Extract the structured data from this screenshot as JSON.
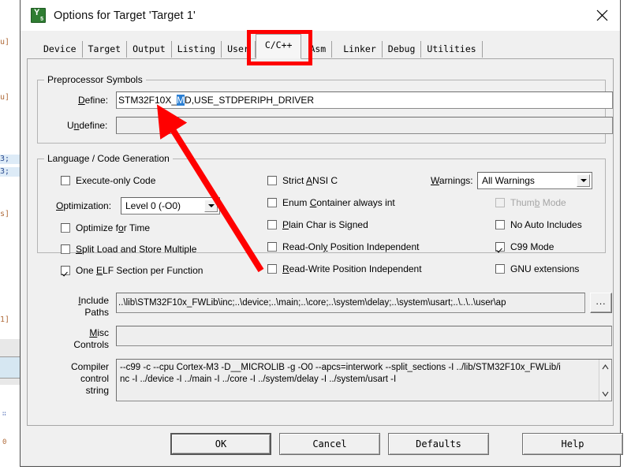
{
  "window": {
    "title": "Options for Target 'Target 1'",
    "icon": "keil-uvision-icon",
    "close_label": "×"
  },
  "tabs": [
    {
      "label": "Device",
      "selected": false
    },
    {
      "label": "Target",
      "selected": false
    },
    {
      "label": "Output",
      "selected": false
    },
    {
      "label": "Listing",
      "selected": false
    },
    {
      "label": "User",
      "selected": false
    },
    {
      "label": "C/C++",
      "selected": true
    },
    {
      "label": "Asm",
      "selected": false
    },
    {
      "label": "Linker",
      "selected": false
    },
    {
      "label": "Debug",
      "selected": false
    },
    {
      "label": "Utilities",
      "selected": false
    }
  ],
  "preprocessor": {
    "legend": "Preprocessor Symbols",
    "define_label": "Define:",
    "define_value_before": "STM32F10X_",
    "define_value_selected": "M",
    "define_value_after": "D,USE_STDPERIPH_DRIVER",
    "define_full_value": "STM32F10X_MD,USE_STDPERIPH_DRIVER",
    "undefine_label": "Undefine:",
    "undefine_value": ""
  },
  "language": {
    "legend": "Language / Code Generation",
    "left_column": [
      {
        "label": "Execute-only Code",
        "checked": false,
        "disabled": false
      },
      {
        "label": "Optimize for Time",
        "checked": false,
        "disabled": false
      },
      {
        "label": "Split Load and Store Multiple",
        "checked": false,
        "disabled": false
      },
      {
        "label": "One ELF Section per Function",
        "checked": true,
        "disabled": false
      }
    ],
    "optimization_label": "Optimization:",
    "optimization_value": "Level 0 (-O0)",
    "middle_column": [
      {
        "label": "Strict ANSI C",
        "checked": false,
        "disabled": false
      },
      {
        "label": "Enum Container always int",
        "checked": false,
        "disabled": false
      },
      {
        "label": "Plain Char is Signed",
        "checked": false,
        "disabled": false
      },
      {
        "label": "Read-Only Position Independent",
        "checked": false,
        "disabled": false
      },
      {
        "label": "Read-Write Position Independent",
        "checked": false,
        "disabled": false
      }
    ],
    "warnings_label": "Warnings:",
    "warnings_value": "All Warnings",
    "right_column": [
      {
        "label": "Thumb Mode",
        "checked": false,
        "disabled": true
      },
      {
        "label": "No Auto Includes",
        "checked": false,
        "disabled": false
      },
      {
        "label": "C99 Mode",
        "checked": true,
        "disabled": false
      },
      {
        "label": "GNU extensions",
        "checked": false,
        "disabled": false
      }
    ]
  },
  "paths": {
    "include_label_line1": "Include",
    "include_label_line2": "Paths",
    "include_value": "..\\lib\\STM32F10x_FWLib\\inc;..\\device;..\\main;..\\core;..\\system\\delay;..\\system\\usart;..\\..\\..\\user\\ap",
    "browse_label": "...",
    "misc_label_line1": "Misc",
    "misc_label_line2": "Controls",
    "misc_value": "",
    "compiler_label_line1": "Compiler",
    "compiler_label_line2": "control",
    "compiler_label_line3": "string",
    "compiler_value": "--c99 -c --cpu Cortex-M3 -D__MICROLIB -g -O0 --apcs=interwork --split_sections -I ../lib/STM32F10x_FWLib/inc -I ../device -I ../main -I ../core -I ../system/delay -I ../system/usart -I"
  },
  "footer": {
    "ok": "OK",
    "cancel": "Cancel",
    "defaults": "Defaults",
    "help": "Help"
  },
  "annotations": {
    "highlight_rect_target": "C/C++",
    "arrow_points_to": "Define field value"
  },
  "colors": {
    "annotation_red": "#ff0000",
    "selection_blue": "#2a7fd4",
    "dialog_bg": "#f0f0f0",
    "field_bg": "#ffffff"
  }
}
